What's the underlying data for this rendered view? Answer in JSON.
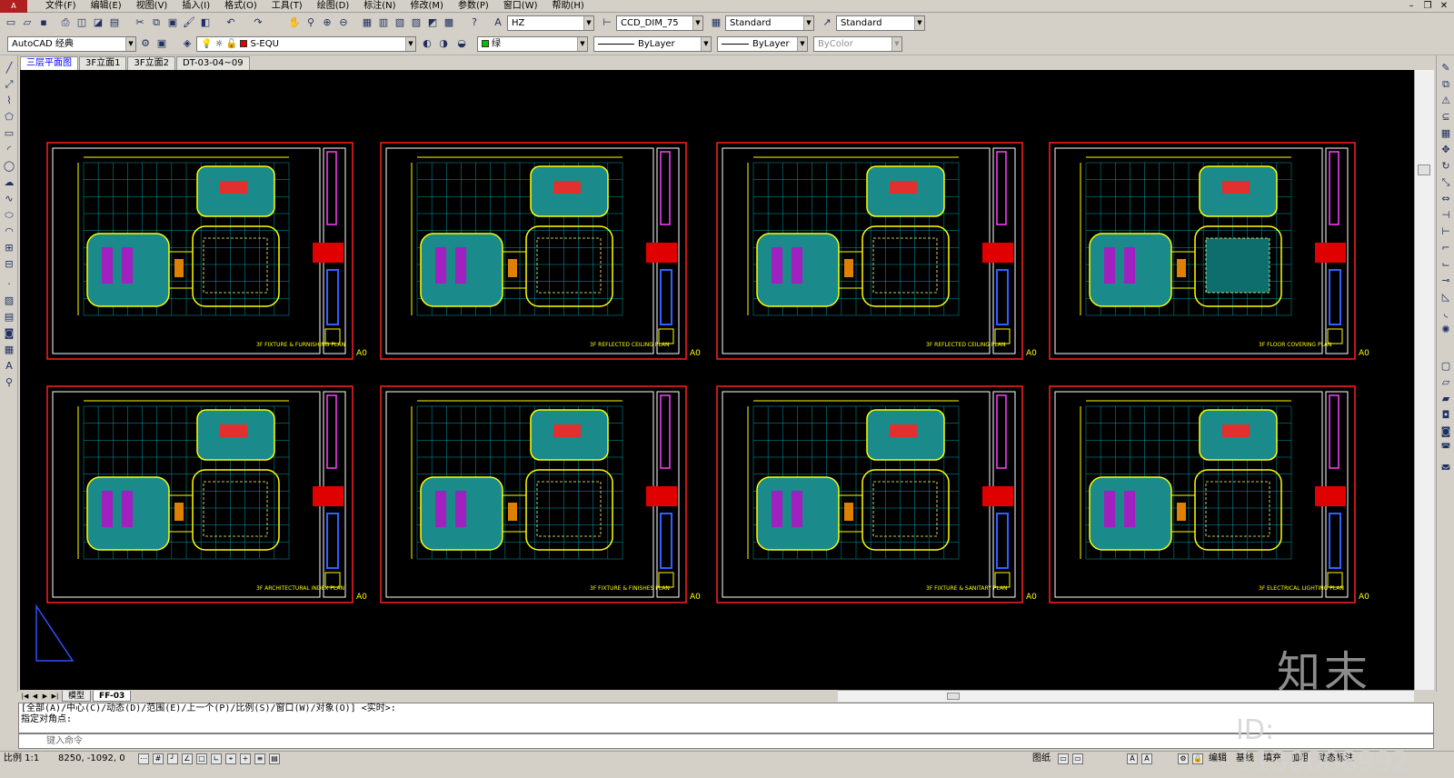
{
  "menu": {
    "items": [
      "文件(F)",
      "编辑(E)",
      "视图(V)",
      "插入(I)",
      "格式(O)",
      "工具(T)",
      "绘图(D)",
      "标注(N)",
      "修改(M)",
      "参数(P)",
      "窗口(W)",
      "帮助(H)"
    ]
  },
  "toolbar1": {
    "text_style": "HZ",
    "dim_style": "CCD_DIM_75",
    "table_style": "Standard",
    "multileader_style": "Standard"
  },
  "toolbar2": {
    "workspace": "AutoCAD 经典",
    "layer": "S-EQU",
    "color": "绿",
    "color_hex": "#00c000",
    "linetype": "ByLayer",
    "lineweight": "ByLayer",
    "plotstyle": "ByColor"
  },
  "doc_tabs": [
    "三层平面图",
    "3F立面1",
    "3F立面2",
    "DT-03-04~09"
  ],
  "sheets": [
    {
      "title": "3F FIXTURE & FURNISHING PLAN",
      "size": "A0"
    },
    {
      "title": "3F REFLECTED CEILING PLAN",
      "size": "A0"
    },
    {
      "title": "3F REFLECTED CEILING PLAN",
      "size": "A0"
    },
    {
      "title": "3F FLOOR COVERING PLAN",
      "size": "A0"
    },
    {
      "title": "3F ARCHITECTURAL INDEX PLAN",
      "size": "A0"
    },
    {
      "title": "3F FIXTURE & FINISHES PLAN",
      "size": "A0"
    },
    {
      "title": "3F FIXTURE & SANITARY PLAN",
      "size": "A0"
    },
    {
      "title": "3F ELECTRICAL LIGHTING PLAN",
      "size": "A0"
    }
  ],
  "layout_tabs": [
    "模型",
    "FF-03"
  ],
  "command": {
    "history_1": "[全部(A)/中心(C)/动态(D)/范围(E)/上一个(P)/比例(S)/窗口(W)/对象(O)] <实时>:",
    "history_2": "指定对角点:",
    "placeholder": "键入命令"
  },
  "status": {
    "scale": "比例 1:1",
    "coords": "8250, -1092, 0",
    "right_items": [
      "图纸",
      "编辑",
      "基线",
      "填充",
      "加粗",
      "动态标注"
    ]
  },
  "watermark": {
    "logo": "知末",
    "id": "ID: 1130008992"
  }
}
